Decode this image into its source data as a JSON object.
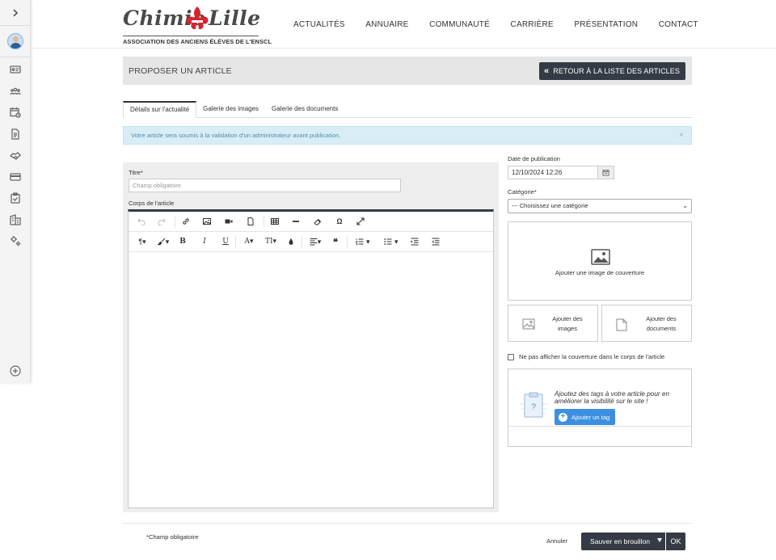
{
  "logo": {
    "word_left": "Chimie",
    "word_right": "Lille",
    "tagline": "ASSOCIATION DES ANCIENS ÉLÈVES DE L'ENSCL",
    "accent": "#d9232e"
  },
  "nav": [
    "ACTUALITÉS",
    "ANNUAIRE",
    "COMMUNAUTÉ",
    "CARRIÈRE",
    "PRÉSENTATION",
    "CONTACT"
  ],
  "rail": {
    "expand_icon": "chevron-right-icon",
    "icons": [
      "id-card-icon",
      "people-icon",
      "calendar-clock-icon",
      "document-icon",
      "handshake-icon",
      "credit-card-icon",
      "clipboard-check-icon",
      "building-icon",
      "settings-icon"
    ],
    "add_icon": "plus-circle-icon"
  },
  "page": {
    "title": "PROPOSER UN ARTICLE",
    "back_label": "RETOUR À LA LISTE DES ARTICLES"
  },
  "tabs": [
    "Détails sur l'actualité",
    "Galerie des images",
    "Galerie des documents"
  ],
  "alert": "Votre article sera soumis à la validation d'un administrateur avant publication.",
  "form": {
    "title_label": "Titre*",
    "title_placeholder": "Champ obligatoire",
    "body_label": "Corps de l'article"
  },
  "right": {
    "date_label": "Date de publication",
    "date_value": "12/10/2024 12:26",
    "category_label": "Catégorie*",
    "category_value": "--- Choisissez une catégorie",
    "cover_label": "Ajouter une image de couverture",
    "add_images": [
      "Ajouter des",
      "images"
    ],
    "add_documents": [
      "Ajouter des",
      "documents"
    ],
    "hide_cover": "Ne pas afficher la couverture dans le corps de l'article",
    "tags_text": "Ajoutez des tags à votre article pour en améliorer la visibilité sur le site !",
    "add_tag": "Ajouter un tag"
  },
  "footer": {
    "required_note": "*Champ obligatoire",
    "cancel": "Annuler",
    "save": "Sauver en brouillon",
    "ok": "OK"
  },
  "colors": {
    "dark_button": "#343b44",
    "alert_bg": "#d9edf7",
    "primary_blue": "#3d8fe0"
  }
}
